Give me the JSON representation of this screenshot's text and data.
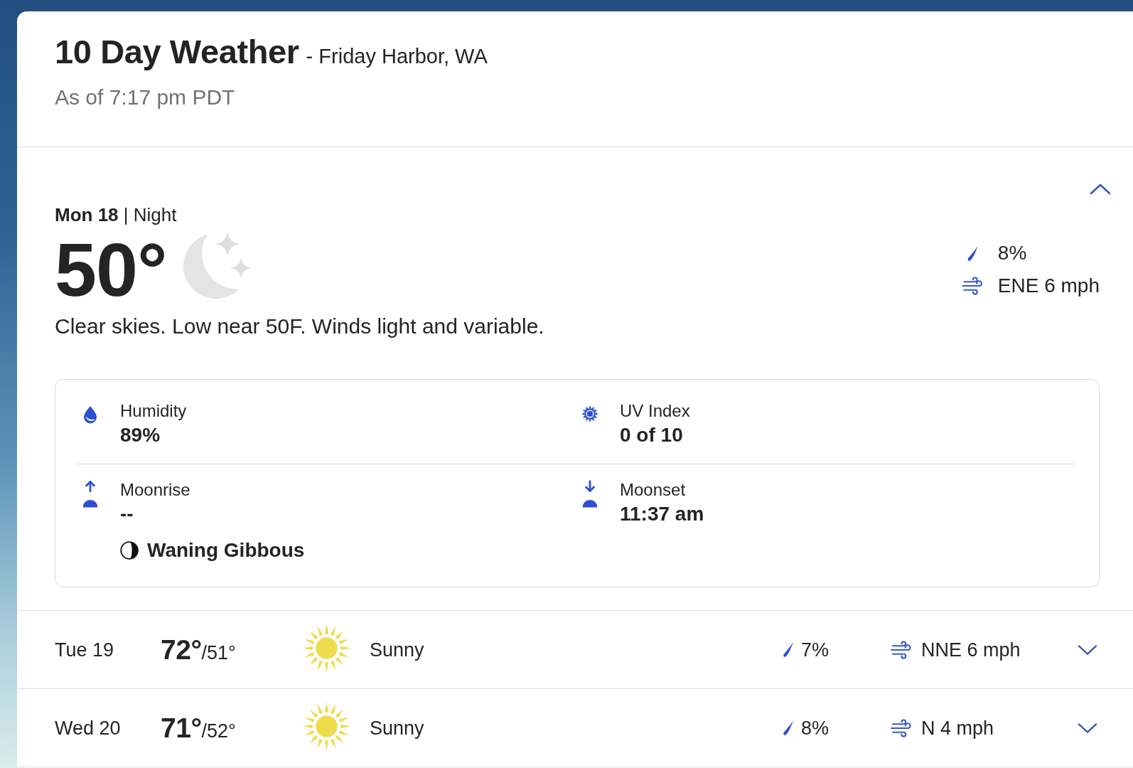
{
  "header": {
    "title": "10 Day Weather",
    "location": "- Friday Harbor, WA",
    "updated": "As of 7:17 pm PDT"
  },
  "current": {
    "expanded": true,
    "day_part": "**Mon 18** | Night",
    "temperature": "50°",
    "precipitation": "8%",
    "wind": "ENE 6 mph",
    "description": "Clear skies. Low near 50F. Winds light and variable.",
    "details": [
      {
        "kind": "humidity",
        "label": "Humidity",
        "value": "89%"
      },
      {
        "kind": "uv",
        "label": "UV Index",
        "value": "0 of 10"
      },
      {
        "kind": "moonrise",
        "label": "Moonrise",
        "value": "--"
      },
      {
        "kind": "moonset",
        "label": "Moonset",
        "value": "11:37 am"
      }
    ],
    "moon_phase": "Waning Gibbous"
  },
  "days": [
    {
      "day": "Tue 19",
      "high": "72°",
      "low": "/51°",
      "condition": "Sunny",
      "precipitation": "7%",
      "wind": "NNE 6 mph",
      "expanded": false
    },
    {
      "day": "Wed 20",
      "high": "71°",
      "low": "/52°",
      "condition": "Sunny",
      "precipitation": "8%",
      "wind": "N 4 mph",
      "expanded": false
    }
  ]
}
